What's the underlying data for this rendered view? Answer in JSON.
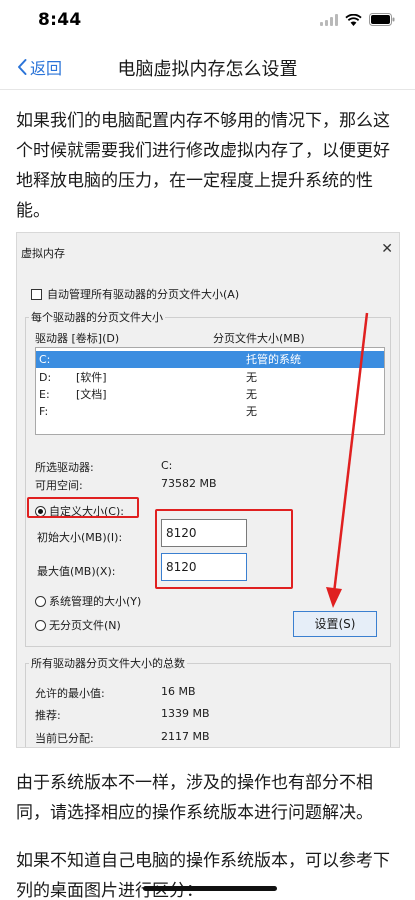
{
  "status": {
    "time": "8:44"
  },
  "nav": {
    "back": "返回",
    "title": "电脑虚拟内存怎么设置"
  },
  "article": {
    "intro": "如果我们的电脑配置内存不够用的情况下，那么这个时候就需要我们进行修改虚拟内存了，以便更好地释放电脑的压力，在一定程度上提升系统的性能。",
    "para2": "由于系统版本不一样，涉及的操作也有部分不相同，请选择相应的操作系统版本进行问题解决。",
    "para3": "如果不知道自己电脑的操作系统版本，可以参考下列的桌面图片进行区分："
  },
  "dialog": {
    "title": "虚拟内存",
    "close": "✕",
    "auto_manage": "自动管理所有驱动器的分页文件大小(A)",
    "group_each": "每个驱动器的分页文件大小",
    "col_drive": "驱动器 [卷标](D)",
    "col_size": "分页文件大小(MB)",
    "drives": [
      {
        "drive": "C:",
        "label": "",
        "size": "托管的系统"
      },
      {
        "drive": "D:",
        "label": "[软件]",
        "size": "无"
      },
      {
        "drive": "E:",
        "label": "[文档]",
        "size": "无"
      },
      {
        "drive": "F:",
        "label": "",
        "size": "无"
      }
    ],
    "selected_drive_label": "所选驱动器:",
    "selected_drive_value": "C:",
    "free_space_label": "可用空间:",
    "free_space_value": "73582 MB",
    "custom_size": "自定义大小(C):",
    "initial_size_label": "初始大小(MB)(I):",
    "initial_size_value": "8120",
    "max_size_label": "最大值(MB)(X):",
    "max_size_value": "8120",
    "system_managed": "系统管理的大小(Y)",
    "no_paging": "无分页文件(N)",
    "set_button": "设置(S)",
    "group_total": "所有驱动器分页文件大小的总数",
    "min_allowed_label": "允许的最小值:",
    "min_allowed_value": "16 MB",
    "recommended_label": "推荐:",
    "recommended_value": "1339 MB",
    "current_label": "当前已分配:",
    "current_value": "2117 MB"
  },
  "colors": {
    "accent": "#2b74d8",
    "highlight": "#e02020",
    "selection": "#3b8de0"
  }
}
